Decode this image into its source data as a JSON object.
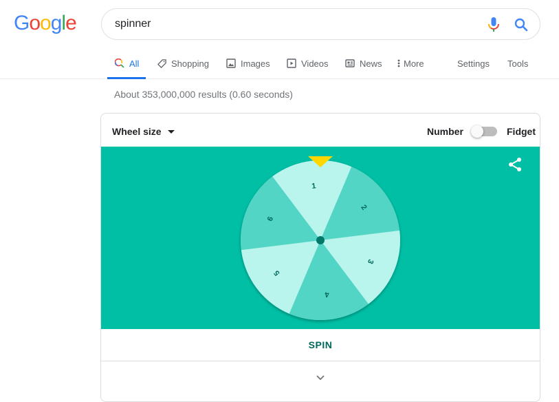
{
  "logo": {
    "letters": [
      {
        "ch": "G",
        "color": "#4285f4"
      },
      {
        "ch": "o",
        "color": "#ea4335"
      },
      {
        "ch": "o",
        "color": "#fbbc05"
      },
      {
        "ch": "g",
        "color": "#4285f4"
      },
      {
        "ch": "l",
        "color": "#34a853"
      },
      {
        "ch": "e",
        "color": "#ea4335"
      }
    ]
  },
  "search": {
    "value": "spinner",
    "mic_icon": "microphone-icon",
    "search_icon": "search-icon"
  },
  "tabs": [
    {
      "label": "All",
      "icon": "search-icon",
      "active": true
    },
    {
      "label": "Shopping",
      "icon": "tag-icon",
      "active": false
    },
    {
      "label": "Images",
      "icon": "image-icon",
      "active": false
    },
    {
      "label": "Videos",
      "icon": "play-icon",
      "active": false
    },
    {
      "label": "News",
      "icon": "newspaper-icon",
      "active": false
    },
    {
      "label": "More",
      "icon": "more-vert-icon",
      "active": false
    }
  ],
  "tools": {
    "settings": "Settings",
    "tools": "Tools"
  },
  "result_stats": "About 353,000,000 results (0.60 seconds)",
  "spinner_card": {
    "wheel_size_label": "Wheel size",
    "mode_left": "Number",
    "mode_right": "Fidget",
    "toggle_on": false,
    "share_icon": "share-icon",
    "wheel": {
      "segments": [
        "1",
        "2",
        "3",
        "4",
        "5",
        "6"
      ],
      "colors": {
        "light": "#b9f4ed",
        "dark": "#52d5c5",
        "background": "#00bfa5",
        "hub": "#00796b",
        "pointer": "#ffd600",
        "label": "#00695c"
      }
    },
    "spin_label": "SPIN",
    "expand_icon": "chevron-down-icon"
  }
}
